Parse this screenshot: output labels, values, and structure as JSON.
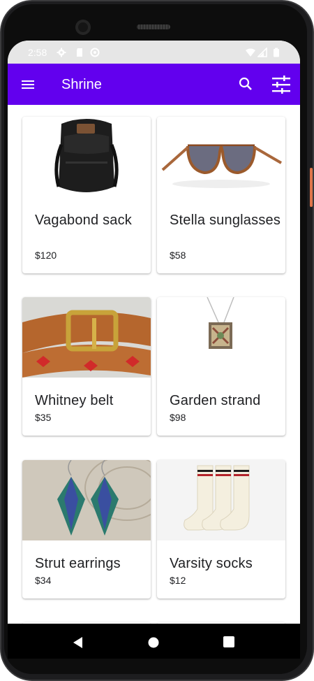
{
  "status_bar": {
    "time": "2:58",
    "icons": [
      "settings-icon",
      "sd-card-icon",
      "sync-icon",
      "wifi-icon",
      "signal-icon",
      "battery-icon"
    ]
  },
  "app_bar": {
    "title": "Shrine",
    "background": "#6200ee",
    "icons": [
      "menu-icon",
      "search-icon",
      "filter-icon"
    ]
  },
  "products": [
    {
      "title": "Vagabond sack",
      "price": "$120",
      "image": "backpack"
    },
    {
      "title": "Stella sunglasses",
      "price": "$58",
      "image": "sunglasses"
    },
    {
      "title": "Whitney belt",
      "price": "$35",
      "image": "belt"
    },
    {
      "title": "Garden strand",
      "price": "$98",
      "image": "necklace"
    },
    {
      "title": "Strut earrings",
      "price": "$34",
      "image": "earrings"
    },
    {
      "title": "Varsity socks",
      "price": "$12",
      "image": "socks"
    }
  ],
  "nav_bar": {
    "icons": [
      "back-icon",
      "home-icon",
      "recents-icon"
    ]
  }
}
